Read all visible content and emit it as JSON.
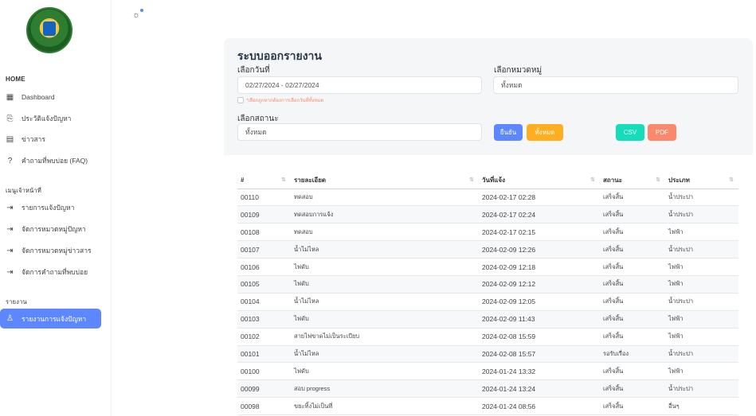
{
  "sidebar": {
    "sections": [
      {
        "header": "HOME",
        "items": [
          {
            "label": "Dashboard",
            "icon": "dashboard-icon"
          },
          {
            "label": "ประวัติแจ้งปัญหา",
            "icon": "history-icon"
          },
          {
            "label": "ข่าวสาร",
            "icon": "news-icon"
          },
          {
            "label": "คำถามที่พบบ่อย (FAQ)",
            "icon": "question-icon"
          }
        ]
      },
      {
        "header": "เมนูเจ้าหน้าที่",
        "items": [
          {
            "label": "รายการแจ้งปัญหา",
            "icon": "login-icon"
          },
          {
            "label": "จัดการหมวดหมู่ปัญหา",
            "icon": "login-icon"
          },
          {
            "label": "จัดการหมวดหมู่ข่าวสาร",
            "icon": "login-icon"
          },
          {
            "label": "จัดการคำถามที่พบบ่อย",
            "icon": "login-icon"
          }
        ]
      },
      {
        "header": "รายงาน",
        "items": [
          {
            "label": "รายงานการแจ้งปัญหา",
            "icon": "user-icon",
            "active": true
          }
        ]
      }
    ]
  },
  "report": {
    "title": "ระบบออกรายงาน",
    "date_label": "เลือกวันที่",
    "date_value": "02/27/2024 - 02/27/2024",
    "date_hint": "*เลือกถูกหากต้องการเลือกวันที่ทั้งหมด",
    "category_label": "เลือกหมวดหมู่",
    "category_value": "ทั้งหมด",
    "status_label": "เลือกสถานะ",
    "status_value": "ทั้งหมด",
    "buttons": {
      "confirm": "ยืนยัน",
      "all": "ทั้งหมด",
      "csv": "CSV",
      "pdf": "PDF"
    },
    "colors": {
      "confirm": "#5d87ff",
      "all": "#ffae1f",
      "csv": "#13deb9",
      "pdf": "#fa896b",
      "active": "#5d87ff"
    }
  },
  "table": {
    "columns": [
      "#",
      "รายละเอียด",
      "วันที่แจ้ง",
      "สถานะ",
      "ประเภท"
    ],
    "rows": [
      [
        "00110",
        "ทดสอบ",
        "2024-02-17 02:28",
        "เสร็จสิ้น",
        "น้ำประปา"
      ],
      [
        "00109",
        "ทดสอบการแจ้ง",
        "2024-02-17 02:24",
        "เสร็จสิ้น",
        "น้ำประปา"
      ],
      [
        "00108",
        "ทดสอบ",
        "2024-02-17 02:15",
        "เสร็จสิ้น",
        "ไฟฟ้า"
      ],
      [
        "00107",
        "น้ำไม่ไหล",
        "2024-02-09 12:26",
        "เสร็จสิ้น",
        "น้ำประปา"
      ],
      [
        "00106",
        "ไฟดับ",
        "2024-02-09 12:18",
        "เสร็จสิ้น",
        "ไฟฟ้า"
      ],
      [
        "00105",
        "ไฟดับ",
        "2024-02-09 12:12",
        "เสร็จสิ้น",
        "ไฟฟ้า"
      ],
      [
        "00104",
        "น้ำไม่ไหล",
        "2024-02-09 12:05",
        "เสร็จสิ้น",
        "น้ำประปา"
      ],
      [
        "00103",
        "ไฟดับ",
        "2024-02-09 11:43",
        "เสร็จสิ้น",
        "ไฟฟ้า"
      ],
      [
        "00102",
        "สายไฟขาดไม่เป็นระเบียบ",
        "2024-02-08 15:59",
        "เสร็จสิ้น",
        "ไฟฟ้า"
      ],
      [
        "00101",
        "น้ำไม่ไหล",
        "2024-02-08 15:57",
        "รอรับเรื่อง",
        "น้ำประปา"
      ],
      [
        "00100",
        "ไฟดับ",
        "2024-01-24 13:32",
        "เสร็จสิ้น",
        "ไฟฟ้า"
      ],
      [
        "00099",
        "สอบ progress",
        "2024-01-24 13:24",
        "เสร็จสิ้น",
        "น้ำประปา"
      ],
      [
        "00098",
        "ขยะทิ้งไม่เป็นที่",
        "2024-01-24 08:56",
        "เสร็จสิ้น",
        "อื่นๆ"
      ]
    ]
  }
}
